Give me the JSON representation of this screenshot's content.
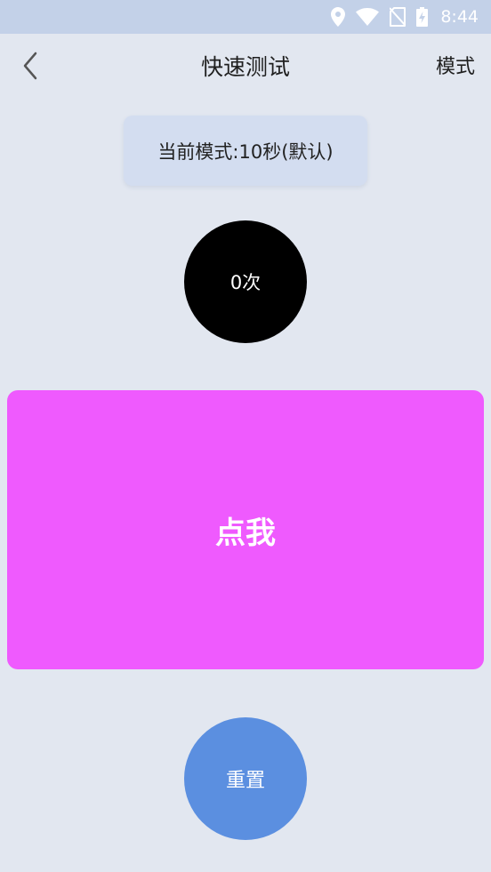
{
  "status_bar": {
    "time": "8:44",
    "icons": [
      "location-icon",
      "wifi-icon",
      "no-sim-icon",
      "battery-charging-icon"
    ]
  },
  "header": {
    "title": "快速测试",
    "mode_label": "模式",
    "back_icon": "chevron-left-icon"
  },
  "mode_chip": {
    "text": "当前模式:10秒(默认)"
  },
  "counter": {
    "text": "0次"
  },
  "tap_area": {
    "label": "点我"
  },
  "reset": {
    "label": "重置"
  },
  "colors": {
    "background": "#e2e7f0",
    "status_bar": "#c3d1e8",
    "chip": "#d3ddf0",
    "counter": "#000000",
    "tap_area": "#ef5afe",
    "reset": "#5b8fe0"
  }
}
